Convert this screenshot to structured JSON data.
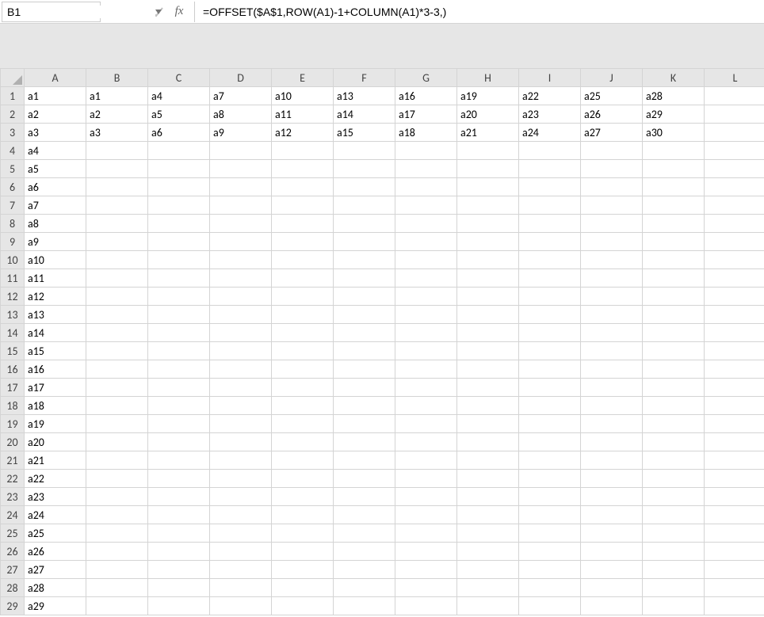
{
  "nameBox": {
    "value": "B1"
  },
  "formulaBar": {
    "value": "=OFFSET($A$1,ROW(A1)-1+COLUMN(A1)*3-3,)"
  },
  "fxLabel": "fx",
  "columns": [
    "A",
    "B",
    "C",
    "D",
    "E",
    "F",
    "G",
    "H",
    "I",
    "J",
    "K",
    "L"
  ],
  "rowCount": 29,
  "cells": {
    "A1": "a1",
    "A2": "a2",
    "A3": "a3",
    "A4": "a4",
    "A5": "a5",
    "A6": "a6",
    "A7": "a7",
    "A8": "a8",
    "A9": "a9",
    "A10": "a10",
    "A11": "a11",
    "A12": "a12",
    "A13": "a13",
    "A14": "a14",
    "A15": "a15",
    "A16": "a16",
    "A17": "a17",
    "A18": "a18",
    "A19": "a19",
    "A20": "a20",
    "A21": "a21",
    "A22": "a22",
    "A23": "a23",
    "A24": "a24",
    "A25": "a25",
    "A26": "a26",
    "A27": "a27",
    "A28": "a28",
    "A29": "a29",
    "B1": "a1",
    "B2": "a2",
    "B3": "a3",
    "C1": "a4",
    "C2": "a5",
    "C3": "a6",
    "D1": "a7",
    "D2": "a8",
    "D3": "a9",
    "E1": "a10",
    "E2": "a11",
    "E3": "a12",
    "F1": "a13",
    "F2": "a14",
    "F3": "a15",
    "G1": "a16",
    "G2": "a17",
    "G3": "a18",
    "H1": "a19",
    "H2": "a20",
    "H3": "a21",
    "I1": "a22",
    "I2": "a23",
    "I3": "a24",
    "J1": "a25",
    "J2": "a26",
    "J3": "a27",
    "K1": "a28",
    "K2": "a29",
    "K3": "a30"
  }
}
